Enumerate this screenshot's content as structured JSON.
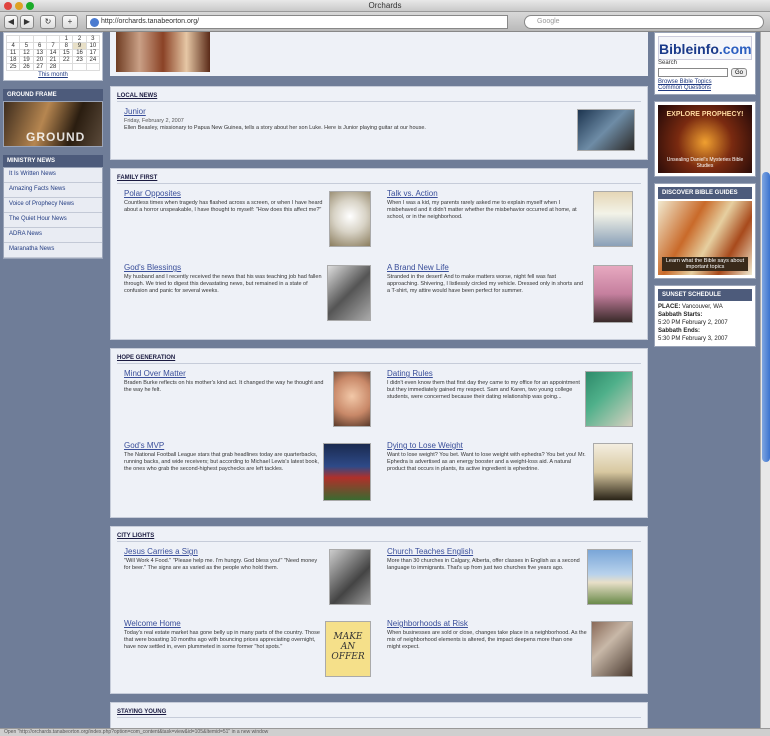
{
  "window": {
    "title": "Orchards"
  },
  "toolbar": {
    "back": "◀",
    "forward": "▶",
    "reload": "↻",
    "add": "+",
    "url": "http://orchards.tanabeorton.org/",
    "search_placeholder": "Google"
  },
  "calendar": {
    "rows": [
      [
        "",
        "",
        "",
        "",
        "1",
        "2",
        "3"
      ],
      [
        "4",
        "5",
        "6",
        "7",
        "8",
        "9",
        "10"
      ],
      [
        "11",
        "12",
        "13",
        "14",
        "15",
        "16",
        "17"
      ],
      [
        "18",
        "19",
        "20",
        "21",
        "22",
        "23",
        "24"
      ],
      [
        "25",
        "26",
        "27",
        "28",
        "",
        "",
        ""
      ]
    ],
    "this_month": "This month"
  },
  "sidebar": {
    "ground_header": "GROUND FRAME",
    "ground_image_text": "GROUND",
    "ministry_header": "MINISTRY NEWS",
    "ministry_items": [
      "It Is Written News",
      "Amazing Facts News",
      "Voice of Prophecy News",
      "The Quiet Hour News",
      "ADRA News",
      "Maranatha News"
    ]
  },
  "local_news": {
    "header": "LOCAL NEWS",
    "title": "Junior",
    "date": "Friday, February 2, 2007",
    "body": "Ellen Beasley, missionary to Papua New Guinea, tells a story about her son Luke. Here is Junior playing guitar at our house."
  },
  "family_first": {
    "header": "FAMILY FIRST",
    "items": [
      {
        "title": "Polar Opposites",
        "body": "Countless times when tragedy has flashed across a screen, or when I have heard about a horror unspeakable, I have thought to myself: \"How does this affect me?\""
      },
      {
        "title": "Talk vs. Action",
        "body": "When I was a kid, my parents rarely asked me to explain myself when I misbehaved and it didn't matter whether the misbehavior occurred at home, at school, or in the neighborhood."
      },
      {
        "title": "God's Blessings",
        "body": "My husband and I recently received the news that his was teaching job had fallen through. We tried to digest this devastating news, but remained in a state of confusion and panic for several weeks."
      },
      {
        "title": "A Brand New Life",
        "body": "Stranded in the desert! And to make matters worse, night fell was fast approaching. Shivering, I listlessly circled my vehicle. Dressed only in shorts and a T-shirt, my attire would have been perfect for summer."
      }
    ]
  },
  "hope_generation": {
    "header": "HOPE GENERATION",
    "items": [
      {
        "title": "Mind Over Matter",
        "body": "Braden Burke reflects on his mother's kind act. It changed the way he thought and the way he felt."
      },
      {
        "title": "Dating Rules",
        "body": "I didn't even know them that first day they came to my office for an appointment but they immediately gained my respect. Sam and Karen, two young college students, were concerned because their dating relationship was going..."
      },
      {
        "title": "God's MVP",
        "body": "The National Football League stars that grab headlines today are quarterbacks, running backs, and wide receivers; but according to Michael Lewis's latest book, the ones who grab the second-highest paychecks are left tackles."
      },
      {
        "title": "Dying to Lose Weight",
        "body": "Want to lose weight? You bet. Want to lose weight with ephedra? You bet you! Mr. Ephedra is advertised as an energy booster and a weight-loss aid. A natural product that occurs in plants, its active ingredient is ephedrine."
      }
    ]
  },
  "city_lights": {
    "header": "CITY LIGHTS",
    "items": [
      {
        "title": "Jesus Carries a Sign",
        "body": "\"Will Work 4 Food.\" \"Please help me. I'm hungry. God bless you!\" \"Need money for beer.\" The signs are as varied as the people who hold them."
      },
      {
        "title": "Church Teaches English",
        "body": "More than 30 churches in Calgary, Alberta, offer classes in English as a second language to immigrants. That's up from just two churches five years ago."
      },
      {
        "title": "Welcome Home",
        "body": "Today's real estate market has gone belly up in many parts of the country. Those that were boasting 10 months ago with bouncing prices appreciating overnight, have now settled in, even plummeted in some former \"hot spots.\""
      },
      {
        "title": "Neighborhoods at Risk",
        "body": "When businesses are sold or close, changes take place in a neighborhood. As the mix of neighborhood elements is altered, the impact deepens more than one might expect."
      }
    ],
    "sign_text": "MAKE AN OFFER"
  },
  "staying_young": {
    "header": "STAYING YOUNG"
  },
  "right": {
    "logo_main": "Bibleinfo",
    "logo_com": ".com",
    "search_label": "Search",
    "go_label": "Go",
    "links": [
      "Browse Bible Topics",
      "Common Questions"
    ],
    "explore_title": "EXPLORE PROPHECY!",
    "explore_sub": "Unsealing Daniel's Mysteries Bible Studies",
    "bible_guides_header": "DISCOVER BIBLE GUIDES",
    "books_caption": "Learn what the Bible says about important topics",
    "sunset_header": "SUNSET SCHEDULE",
    "place_label": "PLACE:",
    "place_value": "Vancouver, WA",
    "starts_label": "Sabbath Starts:",
    "starts_value": "5:20 PM February 2, 2007",
    "ends_label": "Sabbath Ends:",
    "ends_value": "5:30 PM February 3, 2007"
  },
  "status": {
    "text": "Open \"http://orchards.tanabeorton.org/index.php?option=com_content&task=view&id=105&Itemid=51\" in a new window"
  }
}
